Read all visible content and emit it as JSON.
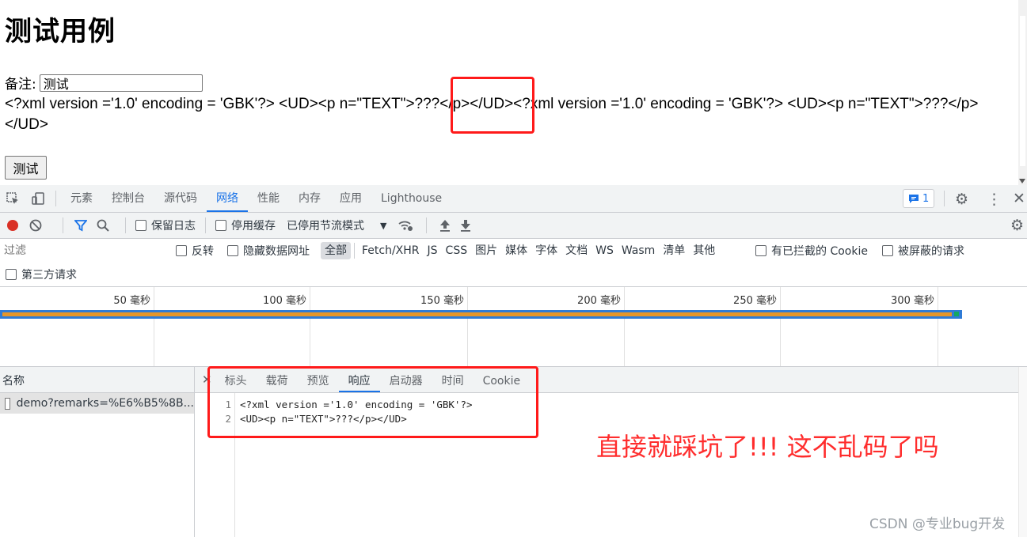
{
  "page": {
    "title": "测试用例",
    "remark_label": "备注:",
    "remark_value": "测试",
    "xml_output": "<?xml version ='1.0' encoding = 'GBK'?> <UD><p n=\"TEXT\">???</p></UD><?xml version ='1.0' encoding = 'GBK'?> <UD><p n=\"TEXT\">???</p></UD>",
    "test_button": "测试"
  },
  "devtools": {
    "tabs": [
      "元素",
      "控制台",
      "源代码",
      "网络",
      "性能",
      "内存",
      "应用",
      "Lighthouse"
    ],
    "active_tab": "网络",
    "issues_count": "1",
    "toolbar": {
      "preserve_log": "保留日志",
      "disable_cache": "停用缓存",
      "throttle": "已停用节流模式"
    },
    "filter": {
      "placeholder": "过滤",
      "invert": "反转",
      "hide_data_urls": "隐藏数据网址",
      "types": [
        "全部",
        "Fetch/XHR",
        "JS",
        "CSS",
        "图片",
        "媒体",
        "字体",
        "文档",
        "WS",
        "Wasm",
        "清单",
        "其他"
      ],
      "blocked_cookies": "有已拦截的 Cookie",
      "blocked_requests": "被屏蔽的请求",
      "third_party": "第三方请求"
    },
    "timeline_ticks": [
      "50 毫秒",
      "100 毫秒",
      "150 毫秒",
      "200 毫秒",
      "250 毫秒",
      "300 毫秒"
    ],
    "name_header": "名称",
    "request_name": "demo?remarks=%E6%B5%8B...",
    "detail_tabs": [
      "标头",
      "载荷",
      "预览",
      "响应",
      "启动器",
      "时间",
      "Cookie"
    ],
    "active_detail_tab": "响应",
    "response_lines": [
      {
        "num": "1",
        "text": "<?xml version ='1.0' encoding = 'GBK'?>"
      },
      {
        "num": "2",
        "text": "<UD><p n=\"TEXT\">???</p></UD>"
      }
    ]
  },
  "annotation": "直接就踩坑了!!! 这不乱码了吗",
  "watermark": "CSDN @专业bug开发",
  "colors": {
    "accent": "#1a73e8",
    "annotation_red": "#ff2d2d",
    "record_red": "#d93025"
  }
}
